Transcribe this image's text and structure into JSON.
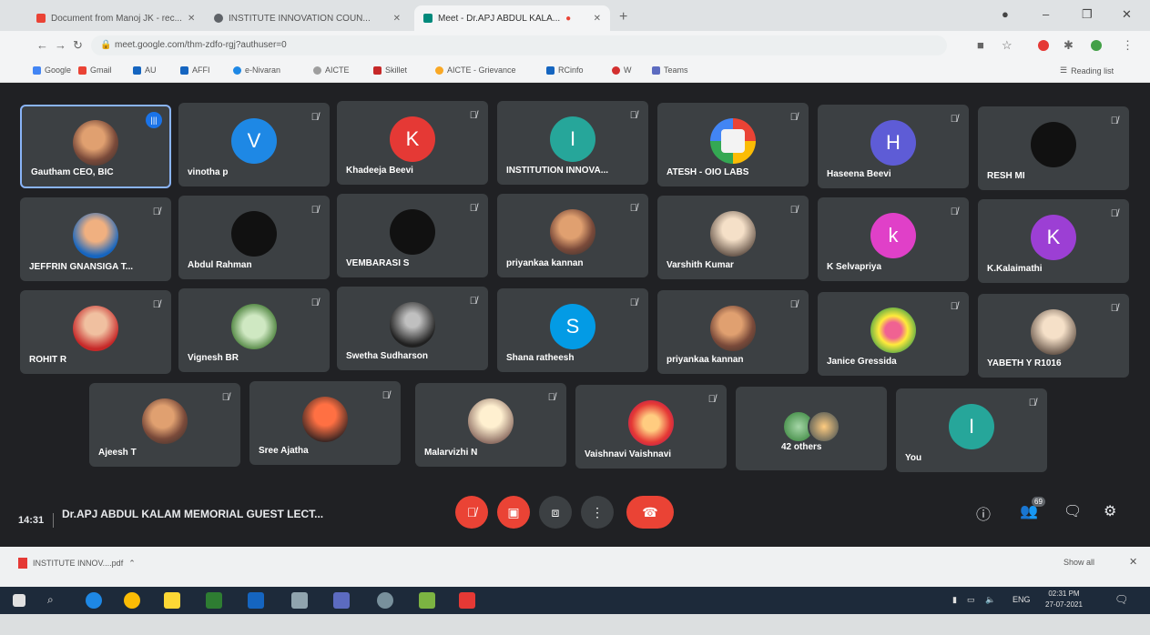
{
  "browser": {
    "tabs": [
      {
        "title": "Document from Manoj JK - rec...",
        "favicon_color": "#ea4335",
        "active": false
      },
      {
        "title": "INSTITUTE INNOVATION COUN...",
        "favicon_color": "#5f6368",
        "active": false
      },
      {
        "title": "Meet - Dr.APJ ABDUL KALA...",
        "favicon_color": "#00897b",
        "active": true
      }
    ],
    "url": "meet.google.com/thm-zdfo-rgj?authuser=0",
    "bookmarks": [
      {
        "label": "Google",
        "color": "#4285f4"
      },
      {
        "label": "Gmail",
        "color": "#ea4335"
      },
      {
        "label": "AU",
        "color": "#1565c0"
      },
      {
        "label": "AFFI",
        "color": "#1565c0"
      },
      {
        "label": "e-Nivaran",
        "color": "#1e88e5"
      },
      {
        "label": "AICTE",
        "color": "#9e9e9e"
      },
      {
        "label": "Skillet",
        "color": "#c62828"
      },
      {
        "label": "AICTE - Grievance",
        "color": "#f9a825"
      },
      {
        "label": "RCinfo",
        "color": "#1565c0"
      },
      {
        "label": "W",
        "color": "#d32f2f"
      },
      {
        "label": "Teams",
        "color": "#5c6bc0"
      }
    ],
    "reading_list": "Reading list"
  },
  "meet": {
    "participants": [
      {
        "name": "Gautham CEO, BIC",
        "avatar_type": "photo",
        "speaking": true
      },
      {
        "name": "vinotha p",
        "avatar_type": "letter",
        "letter": "V",
        "color": "#1e88e5"
      },
      {
        "name": "Khadeeja Beevi",
        "avatar_type": "letter",
        "letter": "K",
        "color": "#e53935"
      },
      {
        "name": "INSTITUTION INNOVA...",
        "avatar_type": "letter",
        "letter": "I",
        "color": "#26a69a"
      },
      {
        "name": "ATESH - OIO LABS",
        "avatar_type": "google"
      },
      {
        "name": "Haseena Beevi",
        "avatar_type": "letter",
        "letter": "H",
        "color": "#5e5cd6"
      },
      {
        "name": "RESH MI",
        "avatar_type": "dark"
      },
      {
        "name": "JEFFRIN GNANSIGA T...",
        "avatar_type": "photo"
      },
      {
        "name": "Abdul Rahman",
        "avatar_type": "dark"
      },
      {
        "name": "VEMBARASI S",
        "avatar_type": "dark"
      },
      {
        "name": "priyankaa kannan",
        "avatar_type": "photo"
      },
      {
        "name": "Varshith Kumar",
        "avatar_type": "dog"
      },
      {
        "name": "K Selvapriya",
        "avatar_type": "letter",
        "letter": "k",
        "color": "#e040c8"
      },
      {
        "name": "K.Kalaimathi",
        "avatar_type": "letter",
        "letter": "K",
        "color": "#9c3fd4"
      },
      {
        "name": "ROHIT R",
        "avatar_type": "photo"
      },
      {
        "name": "Vignesh BR",
        "avatar_type": "green"
      },
      {
        "name": "Swetha Sudharson",
        "avatar_type": "photo"
      },
      {
        "name": "Shana ratheesh",
        "avatar_type": "letter",
        "letter": "S",
        "color": "#039be5"
      },
      {
        "name": "priyankaa kannan",
        "avatar_type": "photo"
      },
      {
        "name": "Janice Gressida",
        "avatar_type": "flowers"
      },
      {
        "name": "YABETH Y R1016",
        "avatar_type": "dog"
      },
      {
        "name": "Ajeesh T",
        "avatar_type": "photo"
      },
      {
        "name": "Sree Ajatha",
        "avatar_type": "photo"
      },
      {
        "name": "Malarvizhi N",
        "avatar_type": "dog"
      },
      {
        "name": "Vaishnavi Vaishnavi",
        "avatar_type": "flowers"
      },
      {
        "name": "42 others",
        "avatar_type": "others"
      },
      {
        "name": "You",
        "avatar_type": "letter",
        "letter": "I",
        "color": "#26a69a"
      }
    ],
    "time": "14:31",
    "meeting_title": "Dr.APJ ABDUL KALAM MEMORIAL GUEST LECT...",
    "people_count": "69"
  },
  "download": {
    "filename": "INSTITUTE INNOV....pdf",
    "show_all": "Show all"
  },
  "taskbar": {
    "lang": "ENG",
    "time": "02:31 PM",
    "date": "27-07-2021"
  }
}
